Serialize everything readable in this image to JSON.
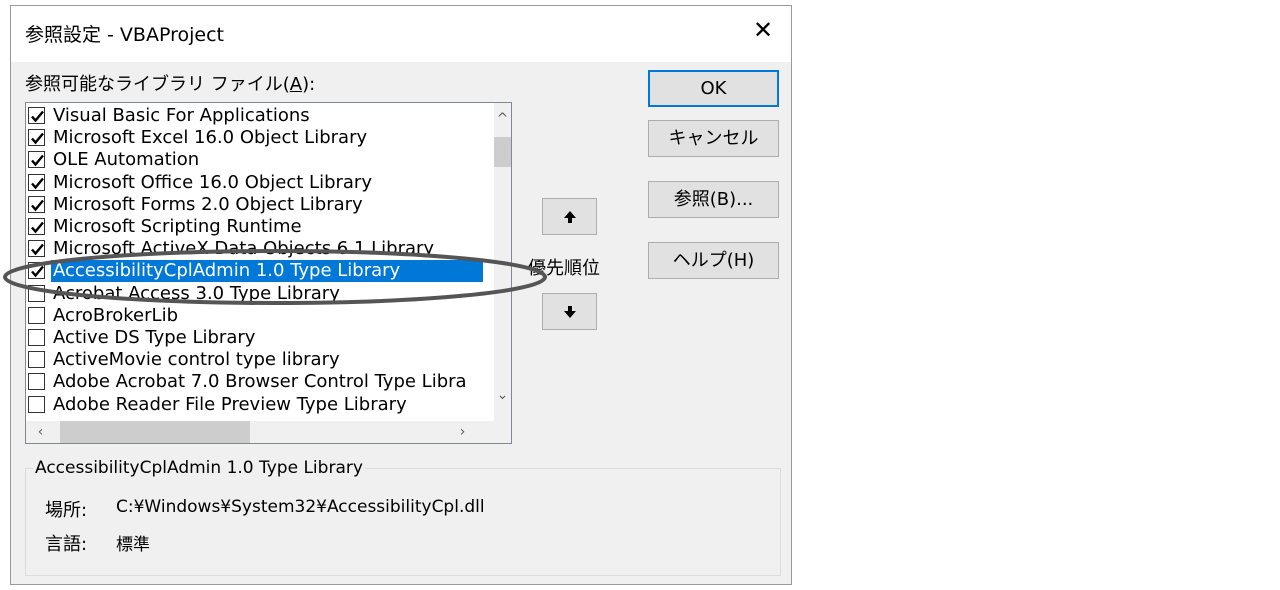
{
  "window": {
    "title": "参照設定 - VBAProject",
    "close_glyph": "✕"
  },
  "list": {
    "label_prefix": "参照可能なライブラリ ファイル(",
    "label_accel": "A",
    "label_suffix": "):",
    "items": [
      {
        "text": "Visual Basic For Applications",
        "checked": true,
        "selected": false
      },
      {
        "text": "Microsoft Excel 16.0 Object Library",
        "checked": true,
        "selected": false
      },
      {
        "text": "OLE Automation",
        "checked": true,
        "selected": false
      },
      {
        "text": "Microsoft Office 16.0 Object Library",
        "checked": true,
        "selected": false
      },
      {
        "text": "Microsoft Forms 2.0 Object Library",
        "checked": true,
        "selected": false
      },
      {
        "text": "Microsoft Scripting Runtime",
        "checked": true,
        "selected": false
      },
      {
        "text": "Microsoft ActiveX Data Objects 6.1 Library",
        "checked": true,
        "selected": false
      },
      {
        "text": "AccessibilityCplAdmin 1.0 Type Library",
        "checked": true,
        "selected": true
      },
      {
        "text": "Acrobat Access 3.0 Type Library",
        "checked": false,
        "selected": false
      },
      {
        "text": "AcroBrokerLib",
        "checked": false,
        "selected": false
      },
      {
        "text": "Active DS Type Library",
        "checked": false,
        "selected": false
      },
      {
        "text": "ActiveMovie control type library",
        "checked": false,
        "selected": false
      },
      {
        "text": "Adobe Acrobat 7.0 Browser Control Type Libra",
        "checked": false,
        "selected": false
      },
      {
        "text": "Adobe Reader File Preview Type Library",
        "checked": false,
        "selected": false
      }
    ]
  },
  "buttons": {
    "ok": "OK",
    "cancel": "キャンセル",
    "browse": "参照(B)...",
    "help": "ヘルプ(H)",
    "up": "🡅",
    "down": "🡇"
  },
  "priority_label": "優先順位",
  "info": {
    "name": "AccessibilityCplAdmin 1.0 Type Library",
    "location_label": "場所:",
    "location_value": "C:¥Windows¥System32¥AccessibilityCpl.dll",
    "language_label": "言語:",
    "language_value": "標準"
  },
  "colors": {
    "selection": "#0078d7",
    "annotation": "#555555"
  }
}
